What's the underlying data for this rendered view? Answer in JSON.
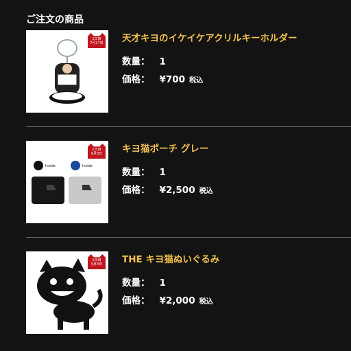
{
  "section_title": "ご注文の商品",
  "labels": {
    "quantity": "数量：",
    "price": "価格：",
    "tax_note": "税込"
  },
  "badge_text": [
    "1日目",
    "7月27日"
  ],
  "items": [
    {
      "name": "天才キヨのイケイケアクリルキーホルダー",
      "quantity": "1",
      "price": "¥700",
      "badge": [
        "1日目",
        "7月27日"
      ]
    },
    {
      "name": "キヨ猫ポーチ グレー",
      "quantity": "1",
      "price": "¥2,500",
      "badge": [
        "1日目",
        "6月3日"
      ],
      "thumb_labels": [
        "Inside",
        "Inside"
      ]
    },
    {
      "name": "THE キヨ猫ぬいぐるみ",
      "quantity": "1",
      "price": "¥2,000",
      "badge": [
        "1日目",
        "5月3日"
      ]
    }
  ],
  "colors": {
    "background": "#131313",
    "accent": "#f2c14e",
    "badge": "#c0161e"
  }
}
